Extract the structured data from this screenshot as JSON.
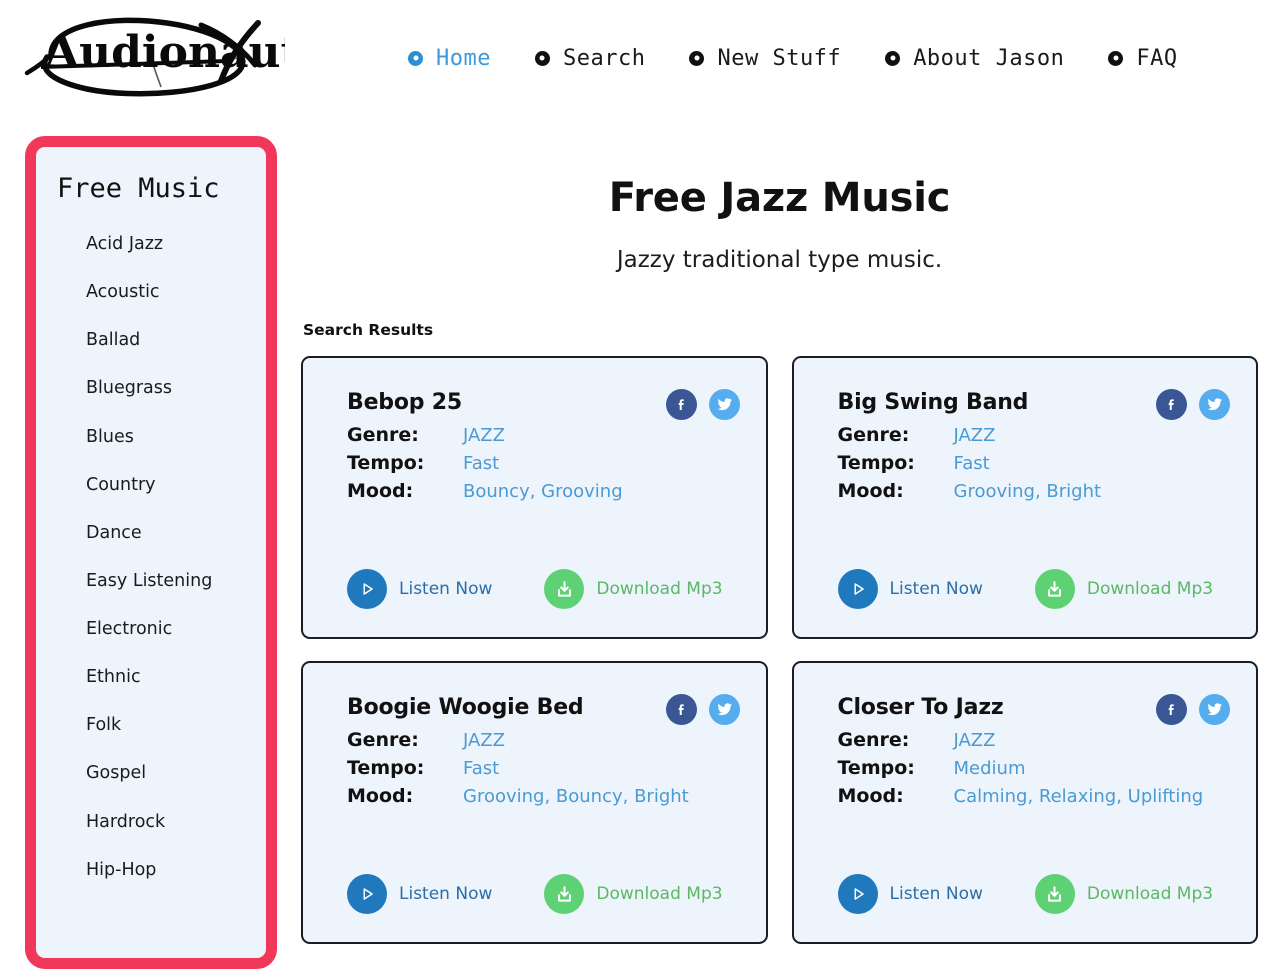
{
  "brand": {
    "logo_text": "Audionautix",
    "logo_icon": "audionautix-swoosh-logo"
  },
  "nav": {
    "items": [
      {
        "label": "Home",
        "icon": "ring-bullet-icon",
        "active": true
      },
      {
        "label": "Search",
        "icon": "ring-bullet-icon",
        "active": false
      },
      {
        "label": "New Stuff",
        "icon": "ring-bullet-icon",
        "active": false
      },
      {
        "label": "About Jason",
        "icon": "ring-bullet-icon",
        "active": false
      },
      {
        "label": "FAQ",
        "icon": "ring-bullet-icon",
        "active": false
      }
    ]
  },
  "sidebar": {
    "title": "Free Music",
    "border_color": "#f2385a",
    "background_color": "#eef4fb",
    "items": [
      {
        "label": "Acid Jazz"
      },
      {
        "label": "Acoustic"
      },
      {
        "label": "Ballad"
      },
      {
        "label": "Bluegrass"
      },
      {
        "label": "Blues"
      },
      {
        "label": "Country"
      },
      {
        "label": "Dance"
      },
      {
        "label": "Easy Listening"
      },
      {
        "label": "Electronic"
      },
      {
        "label": "Ethnic"
      },
      {
        "label": "Folk"
      },
      {
        "label": "Gospel"
      },
      {
        "label": "Hardrock"
      },
      {
        "label": "Hip-Hop"
      }
    ]
  },
  "main": {
    "title": "Free Jazz Music",
    "subtitle": "Jazzy traditional type music.",
    "results_label": "Search Results",
    "labels": {
      "genre": "Genre:",
      "tempo": "Tempo:",
      "mood": "Mood:"
    },
    "actions": {
      "listen_label": "Listen Now",
      "download_label": "Download Mp3",
      "listen_icon": "play-icon",
      "download_icon": "download-icon",
      "facebook_icon": "facebook-icon",
      "twitter_icon": "twitter-icon"
    },
    "colors": {
      "accent_blue": "#4a9bd4",
      "listen_blue": "#2a6ea8",
      "download_green": "#5ab864",
      "facebook_blue": "#3a5694",
      "twitter_blue": "#55acee",
      "card_bg": "#eef4fb",
      "card_border": "#1c1c28"
    },
    "tracks": [
      {
        "title": "Bebop 25",
        "genre": "JAZZ",
        "tempo": "Fast",
        "mood": "Bouncy, Grooving"
      },
      {
        "title": "Big Swing Band",
        "genre": "JAZZ",
        "tempo": "Fast",
        "mood": "Grooving, Bright"
      },
      {
        "title": "Boogie Woogie Bed",
        "genre": "JAZZ",
        "tempo": "Fast",
        "mood": "Grooving, Bouncy, Bright"
      },
      {
        "title": "Closer To Jazz",
        "genre": "JAZZ",
        "tempo": "Medium",
        "mood": "Calming, Relaxing, Uplifting"
      }
    ]
  }
}
